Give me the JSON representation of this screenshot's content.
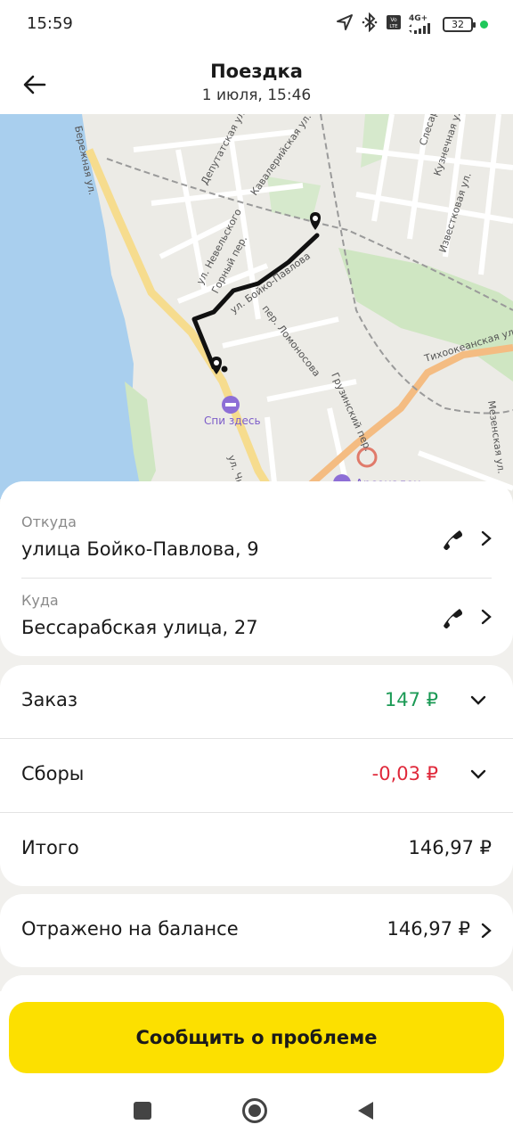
{
  "status_bar": {
    "time": "15:59",
    "network": "4G+",
    "volte": "Vo LTE",
    "battery": "32",
    "icons": [
      "location-arrow-icon",
      "bluetooth-icon",
      "volte-icon",
      "signal-icon",
      "battery-icon",
      "green-dot-icon"
    ]
  },
  "header": {
    "title": "Поездка",
    "subtitle": "1 июля, 15:46",
    "back_icon": "arrow-left-icon"
  },
  "map": {
    "labels": {
      "beregovaya": "Бережная ул.",
      "deputatskaya": "Депутатская ул.",
      "kavaleriyskaya": "Кавалерийская ул.",
      "nevelskogo": "ул. Невельского",
      "gorny": "Горный пер.",
      "boyko": "ул. Бойко-Павлова",
      "lomonosova": "пер. Ломоносова",
      "gruzinsky": "Грузинский пер.",
      "chkalova": "ул. Чкалова",
      "tikhookeanskaya": "Тихоокеанская ул.",
      "mezenskaya": "Мезенская ул.",
      "kuznechnaya": "Кузнечная ул.",
      "izvestkovaya": "Известковая ул.",
      "slesar": "Слесар",
      "poi_hotel": "Спи здесь",
      "poi_arsenal": "Арсеналец"
    },
    "route_color": "#111111",
    "water_color": "#a9cfee"
  },
  "route": {
    "from_label": "Откуда",
    "from_value": "улица Бойко-Павлова, 9",
    "to_label": "Куда",
    "to_value": "Бессарабская улица, 27",
    "phone_icon": "phone-icon",
    "chevron_icon": "chevron-right-icon"
  },
  "price": {
    "order_label": "Заказ",
    "order_value": "147 ₽",
    "fees_label": "Сборы",
    "fees_value": "-0,03 ₽",
    "total_label": "Итого",
    "total_value": "146,97 ₽",
    "positive_color": "#1b9a55",
    "negative_color": "#e0283a"
  },
  "balance": {
    "label": "Отражено на балансе",
    "value": "146,97 ₽"
  },
  "actions": {
    "report_problem": "Сообщить о проблеме",
    "accent_color": "#fce000"
  },
  "navbar": {
    "icons": [
      "recent-apps-icon",
      "home-icon",
      "back-icon"
    ]
  }
}
